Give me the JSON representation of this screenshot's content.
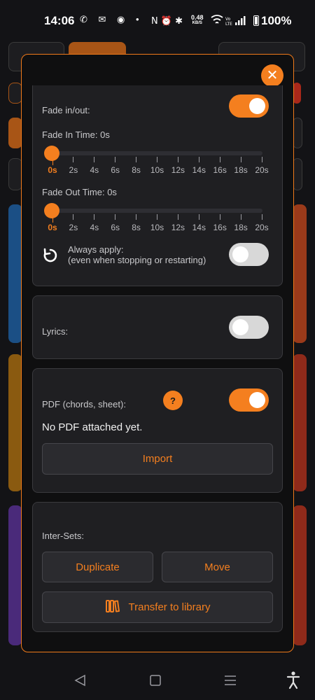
{
  "status": {
    "time": "14:06",
    "left_icons": "✆ ✉ ◉ •",
    "net_speed": "0.48",
    "net_unit": "KB/S",
    "battery": "100%"
  },
  "modal": {
    "close_label": "✕",
    "fade": {
      "label": "Fade in/out:",
      "enabled": true,
      "fade_in_label": "Fade In Time: 0s",
      "fade_out_label": "Fade Out Time: 0s",
      "ticks": [
        "0s",
        "2s",
        "4s",
        "6s",
        "8s",
        "10s",
        "12s",
        "14s",
        "16s",
        "18s",
        "20s"
      ],
      "fade_in_value": 0,
      "fade_out_value": 0,
      "always_apply_label": "Always apply:",
      "always_apply_sub": "(even when stopping or restarting)",
      "always_apply_enabled": false
    },
    "lyrics": {
      "label": "Lyrics:",
      "enabled": false
    },
    "pdf": {
      "label": "PDF (chords, sheet):",
      "help_label": "?",
      "enabled": true,
      "status": "No PDF attached yet.",
      "import_label": "Import"
    },
    "intersets": {
      "label": "Inter-Sets:",
      "duplicate_label": "Duplicate",
      "move_label": "Move",
      "transfer_label": "Transfer to library"
    }
  },
  "colors": {
    "accent": "#f47f1f",
    "panel": "#1f1f22",
    "background": "#0f0f10"
  }
}
